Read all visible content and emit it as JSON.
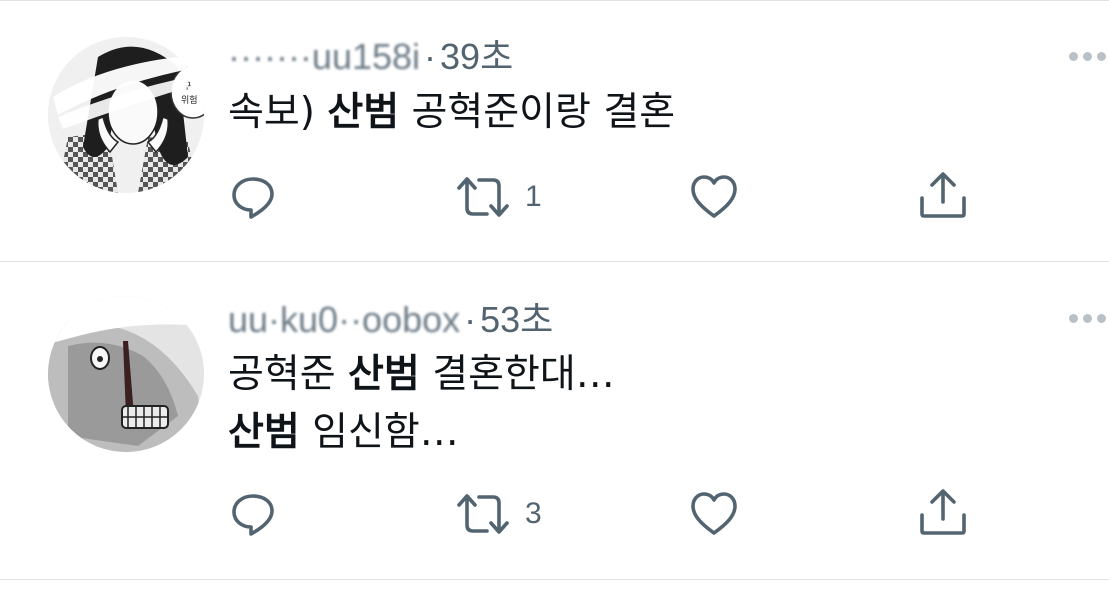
{
  "tweets": [
    {
      "handle": "·······uu158i",
      "separator": "·",
      "time": "39초",
      "lines": [
        [
          {
            "text": "속보) ",
            "bold": false
          },
          {
            "text": "산범",
            "bold": true
          },
          {
            "text": " 공혁준이랑 결혼",
            "bold": false
          }
        ]
      ],
      "retweet_count": "1"
    },
    {
      "handle": "uu·ku0··oobox",
      "separator": "·",
      "time": "53초",
      "lines": [
        [
          {
            "text": "공혁준 ",
            "bold": false
          },
          {
            "text": "산범",
            "bold": true
          },
          {
            "text": " 결혼한대…",
            "bold": false
          }
        ],
        [
          {
            "text": "산범",
            "bold": true
          },
          {
            "text": " 임신함…",
            "bold": false
          }
        ]
      ],
      "retweet_count": "3"
    }
  ],
  "icons": {
    "reply": "reply-bubble-icon",
    "retweet": "retweet-icon",
    "like": "heart-icon",
    "share": "share-upload-icon",
    "more": "more-dots-icon"
  },
  "colors": {
    "text": "#0f1419",
    "secondary": "#536471",
    "divider": "#dfe3e6"
  }
}
